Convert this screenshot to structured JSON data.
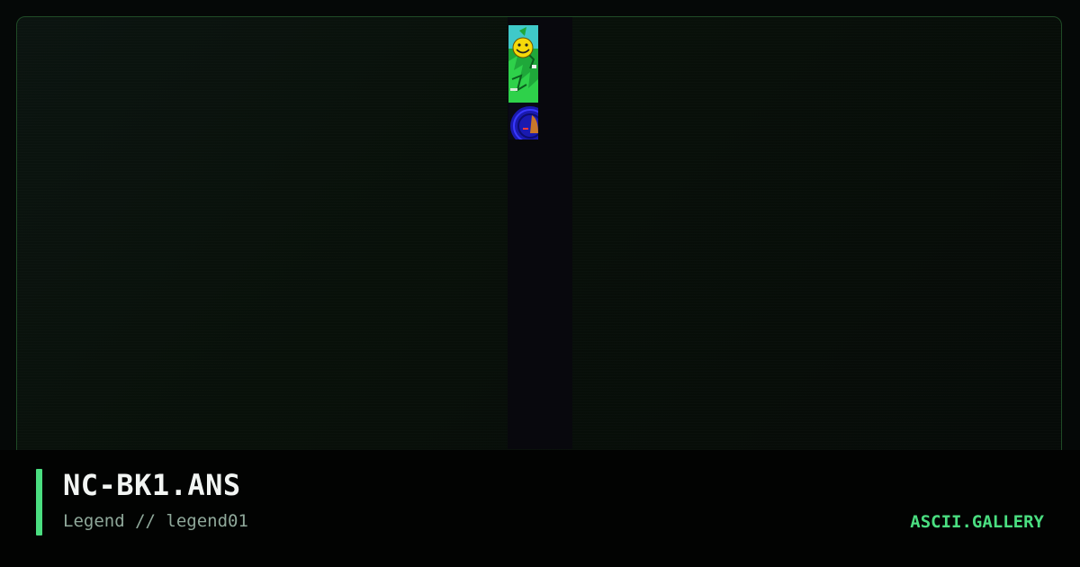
{
  "artwork": {
    "filename": "NC-BK1.ANS",
    "byline": "Legend // legend01"
  },
  "site": {
    "brand": "ASCII.GALLERY"
  },
  "theme": {
    "accent": "#4ade80",
    "border": "#1f4a26",
    "background": "#050807",
    "title_color": "#f2f5f3",
    "subtitle_color": "#8fa89a"
  },
  "icons": {
    "thumbnail": "smiley-face-ansi-art-thumbnail"
  }
}
